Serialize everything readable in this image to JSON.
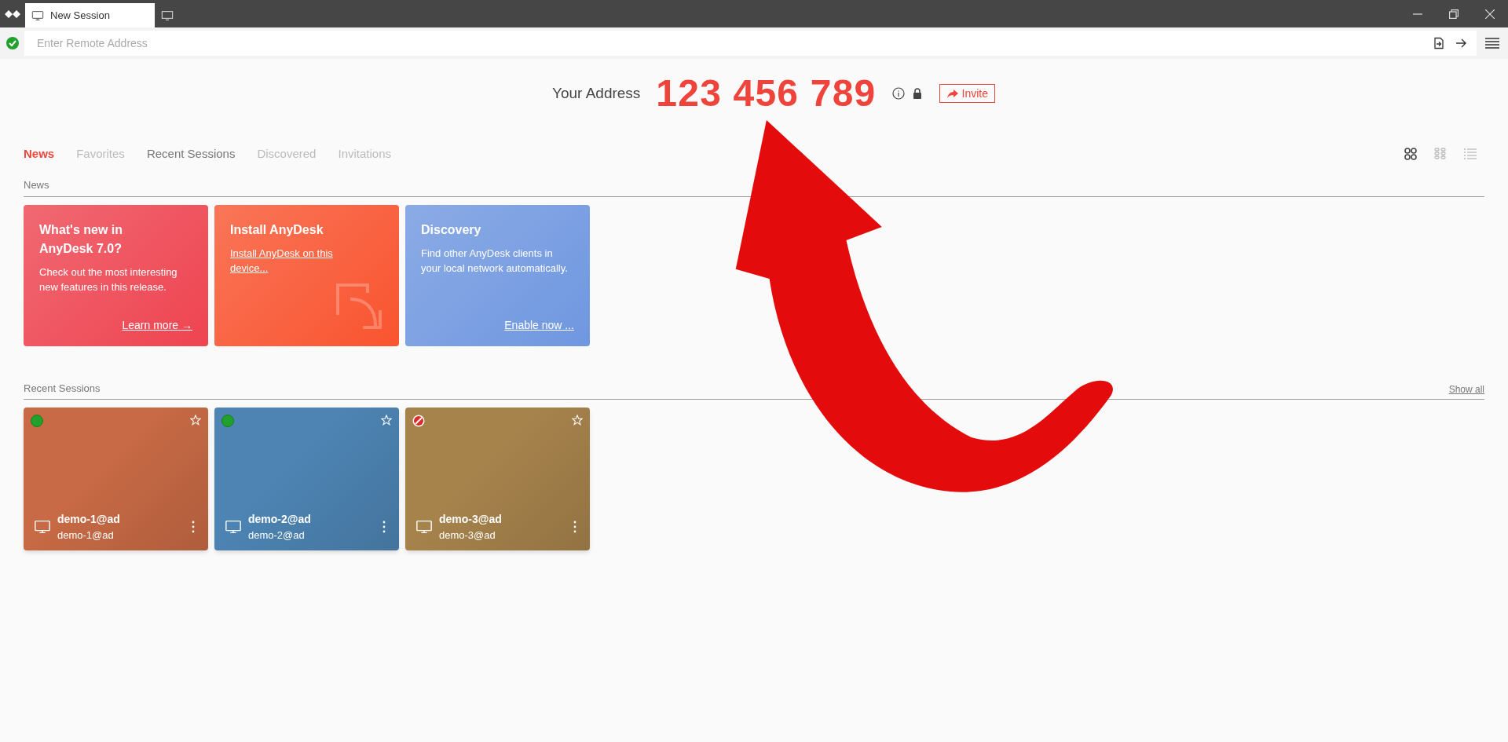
{
  "window": {
    "tabs": [
      {
        "label": "New Session",
        "selected": true
      }
    ]
  },
  "address_bar": {
    "placeholder": "Enter Remote Address",
    "connected": true
  },
  "your_address": {
    "label": "Your Address",
    "value": "123 456 789",
    "invite": "Invite"
  },
  "tabs": [
    {
      "label": "News",
      "selected": true,
      "disabled": false
    },
    {
      "label": "Favorites",
      "selected": false,
      "disabled": true
    },
    {
      "label": "Recent Sessions",
      "selected": false,
      "disabled": false
    },
    {
      "label": "Discovered",
      "selected": false,
      "disabled": true
    },
    {
      "label": "Invitations",
      "selected": false,
      "disabled": true
    }
  ],
  "view_modes": [
    {
      "kind": "tiles",
      "selected": true
    },
    {
      "kind": "small_tiles",
      "selected": false
    },
    {
      "kind": "list",
      "selected": false
    }
  ],
  "news": {
    "heading": "News",
    "cards": [
      {
        "title": "What's new in AnyDesk 7.0?",
        "text": "Check out the most interesting new features in this release.",
        "link": "Learn more →",
        "color": "#ee4450",
        "kind": "bottom_link"
      },
      {
        "title": "Install AnyDesk",
        "link": "Install AnyDesk on this device...",
        "color": "#f9542f",
        "kind": "inline_link"
      },
      {
        "title": "Discovery",
        "text": "Find other AnyDesk clients in your local network automatically.",
        "link": "Enable now ...",
        "color": "#6f97e0",
        "kind": "bottom_link"
      }
    ]
  },
  "recent_sessions": {
    "heading": "Recent Sessions",
    "show_all": "Show all",
    "sessions": [
      {
        "name": "demo-1@ad",
        "address": "demo-1@ad",
        "kind": "online",
        "color": "#c86a45"
      },
      {
        "name": "demo-2@ad",
        "address": "demo-2@ad",
        "kind": "online",
        "color": "#4d84b3"
      },
      {
        "name": "demo-3@ad",
        "address": "demo-3@ad",
        "kind": "blocked",
        "color": "#a7834c"
      }
    ]
  }
}
